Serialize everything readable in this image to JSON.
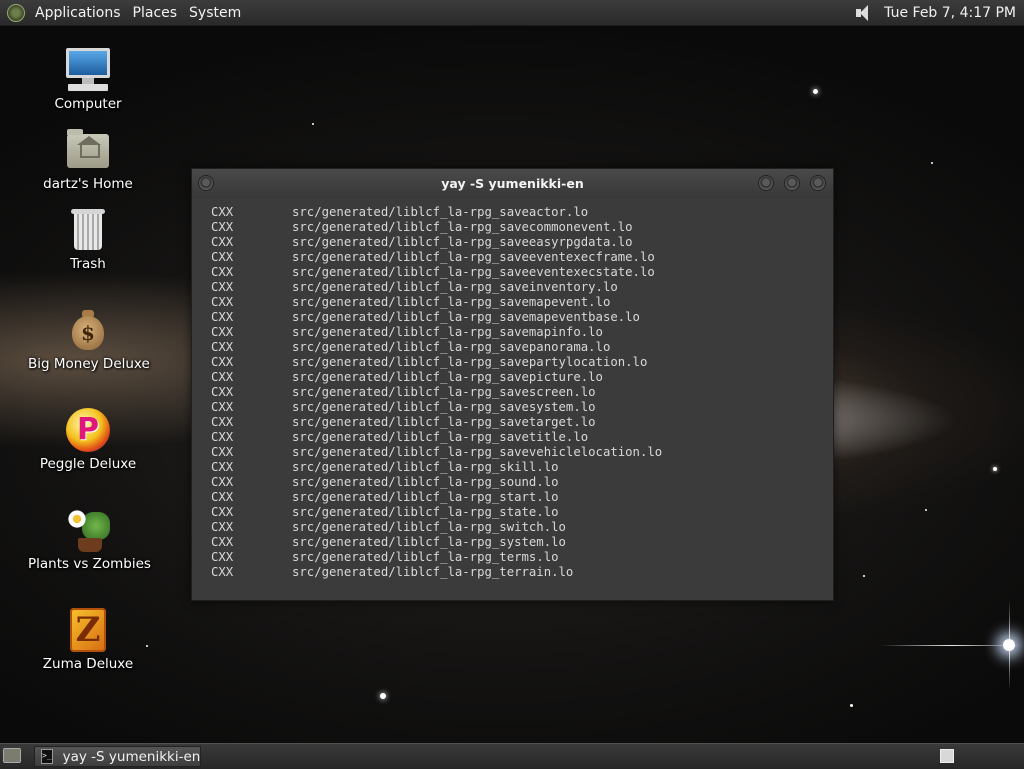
{
  "top_panel": {
    "menus": [
      "Applications",
      "Places",
      "System"
    ],
    "clock": "Tue Feb  7,  4:17 PM",
    "volume_icon": "speaker-icon"
  },
  "desktop_icons": [
    {
      "label": "Computer",
      "icon": "computer-icon"
    },
    {
      "label": "dartz's Home",
      "icon": "home-folder-icon"
    },
    {
      "label": "Trash",
      "icon": "trash-icon"
    },
    {
      "label": "Big Money Deluxe",
      "icon": "money-bag-icon"
    },
    {
      "label": "Peggle Deluxe",
      "icon": "peggle-icon"
    },
    {
      "label": "Plants vs Zombies",
      "icon": "plants-vs-zombies-icon"
    },
    {
      "label": "Zuma Deluxe",
      "icon": "zuma-icon"
    }
  ],
  "terminal": {
    "title": "yay -S yumenikki-en",
    "lines": [
      {
        "tag": "CXX",
        "path": "src/generated/liblcf_la-rpg_saveactor.lo"
      },
      {
        "tag": "CXX",
        "path": "src/generated/liblcf_la-rpg_savecommonevent.lo"
      },
      {
        "tag": "CXX",
        "path": "src/generated/liblcf_la-rpg_saveeasyrpgdata.lo"
      },
      {
        "tag": "CXX",
        "path": "src/generated/liblcf_la-rpg_saveeventexecframe.lo"
      },
      {
        "tag": "CXX",
        "path": "src/generated/liblcf_la-rpg_saveeventexecstate.lo"
      },
      {
        "tag": "CXX",
        "path": "src/generated/liblcf_la-rpg_saveinventory.lo"
      },
      {
        "tag": "CXX",
        "path": "src/generated/liblcf_la-rpg_savemapevent.lo"
      },
      {
        "tag": "CXX",
        "path": "src/generated/liblcf_la-rpg_savemapeventbase.lo"
      },
      {
        "tag": "CXX",
        "path": "src/generated/liblcf_la-rpg_savemapinfo.lo"
      },
      {
        "tag": "CXX",
        "path": "src/generated/liblcf_la-rpg_savepanorama.lo"
      },
      {
        "tag": "CXX",
        "path": "src/generated/liblcf_la-rpg_savepartylocation.lo"
      },
      {
        "tag": "CXX",
        "path": "src/generated/liblcf_la-rpg_savepicture.lo"
      },
      {
        "tag": "CXX",
        "path": "src/generated/liblcf_la-rpg_savescreen.lo"
      },
      {
        "tag": "CXX",
        "path": "src/generated/liblcf_la-rpg_savesystem.lo"
      },
      {
        "tag": "CXX",
        "path": "src/generated/liblcf_la-rpg_savetarget.lo"
      },
      {
        "tag": "CXX",
        "path": "src/generated/liblcf_la-rpg_savetitle.lo"
      },
      {
        "tag": "CXX",
        "path": "src/generated/liblcf_la-rpg_savevehiclelocation.lo"
      },
      {
        "tag": "CXX",
        "path": "src/generated/liblcf_la-rpg_skill.lo"
      },
      {
        "tag": "CXX",
        "path": "src/generated/liblcf_la-rpg_sound.lo"
      },
      {
        "tag": "CXX",
        "path": "src/generated/liblcf_la-rpg_start.lo"
      },
      {
        "tag": "CXX",
        "path": "src/generated/liblcf_la-rpg_state.lo"
      },
      {
        "tag": "CXX",
        "path": "src/generated/liblcf_la-rpg_switch.lo"
      },
      {
        "tag": "CXX",
        "path": "src/generated/liblcf_la-rpg_system.lo"
      },
      {
        "tag": "CXX",
        "path": "src/generated/liblcf_la-rpg_terms.lo"
      },
      {
        "tag": "CXX",
        "path": "src/generated/liblcf_la-rpg_terrain.lo"
      }
    ]
  },
  "bottom_panel": {
    "task_label": "yay -S yumenikki-en",
    "show_desktop_icon": "show-desktop-icon",
    "workspace_icon": "workspace-switcher-icon"
  }
}
